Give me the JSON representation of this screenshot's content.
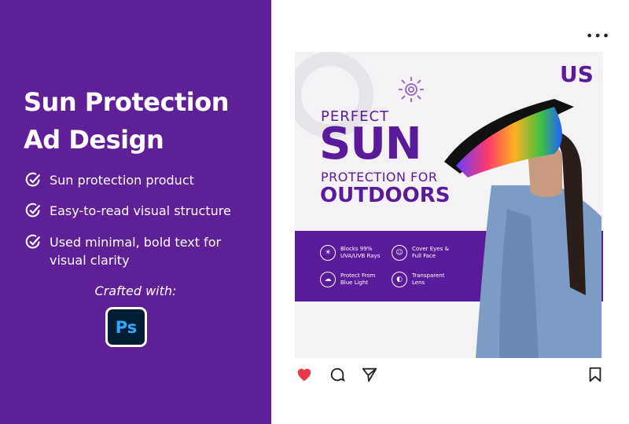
{
  "left_panel": {
    "title_line1": "Sun Protection",
    "title_line2": "Ad Design",
    "features": [
      "Sun protection product",
      "Easy-to-read visual structure",
      "Used minimal, bold text for visual clarity"
    ],
    "crafted_with": "Crafted with:",
    "tool_icon": "Ps",
    "background": "#5f1f96"
  },
  "post": {
    "more_icon": "more-horizontal-icon",
    "ad": {
      "logo": "US",
      "headline_1": "PERFECT",
      "headline_2": "SUN",
      "headline_3": "PROTECTION FOR",
      "headline_4": "OUTDOORS",
      "benefits": [
        "Blocks 99% UVA/UVB Rays",
        "Cover Eyes & Full Face",
        "Protect From Blue Light",
        "Transparent Lens"
      ],
      "accent": "#5a1b9a"
    },
    "actions": [
      "heart-icon",
      "comment-icon",
      "share-icon",
      "bookmark-icon"
    ],
    "like_color": "#e8394b"
  }
}
